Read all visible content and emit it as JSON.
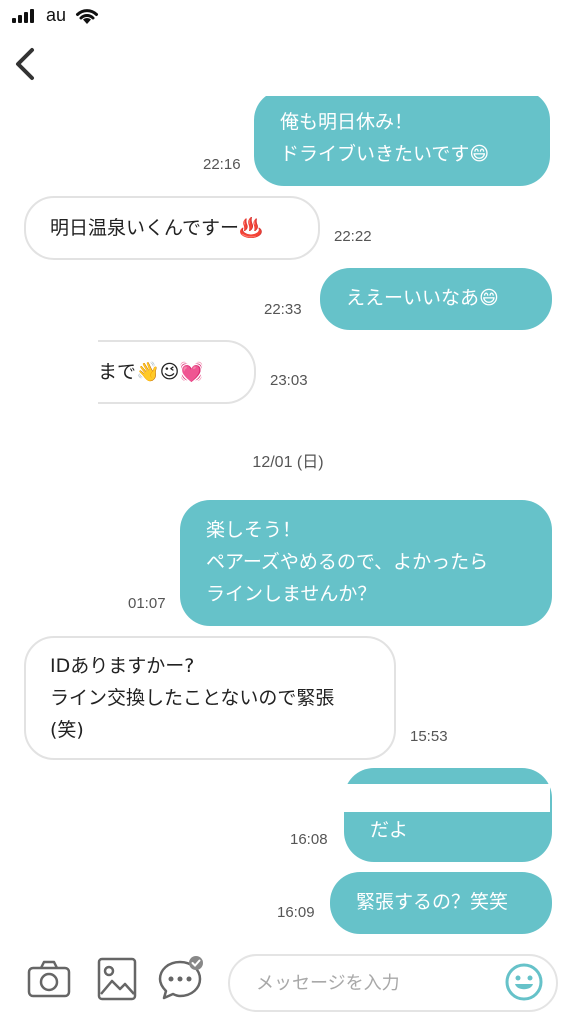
{
  "status_bar": {
    "carrier": "au"
  },
  "header": {
    "back_icon": "chevron-left-icon"
  },
  "messages": [
    {
      "side": "out",
      "lines": [
        "俺も明日休み！",
        "ドライブいきたいです😄"
      ],
      "time": "22:16"
    },
    {
      "side": "in",
      "lines": [
        "明日温泉いくんですー♨️"
      ],
      "time": "22:22"
    },
    {
      "side": "out",
      "lines": [
        "ええーいいなあ😄"
      ],
      "time": "22:33"
    },
    {
      "side": "in",
      "lines": [
        "まで👋😉💓"
      ],
      "time": "23:03"
    },
    {
      "side": "out",
      "lines": [
        "楽しそう！",
        "ペアーズやめるので、よかったら",
        "ラインしませんか？"
      ],
      "time": "01:07"
    },
    {
      "side": "in",
      "lines": [
        "IDありますかー?",
        "ライン交換したことないので緊張",
        "(笑)"
      ],
      "time": "15:53"
    },
    {
      "side": "out",
      "lines": [
        "",
        "だよ"
      ],
      "time": "16:08"
    },
    {
      "side": "out",
      "lines": [
        "緊張するの？笑笑"
      ],
      "time": "16:09"
    }
  ],
  "date_separator": "12/01 (日)",
  "input_bar": {
    "placeholder": "メッセージを入力",
    "icons": [
      "camera-icon",
      "image-icon",
      "chat-template-icon",
      "smile-icon"
    ]
  },
  "colors": {
    "outgoing_bubble": "#66c2c9",
    "incoming_border": "#e2e2e2",
    "accent": "#66c2c9"
  }
}
